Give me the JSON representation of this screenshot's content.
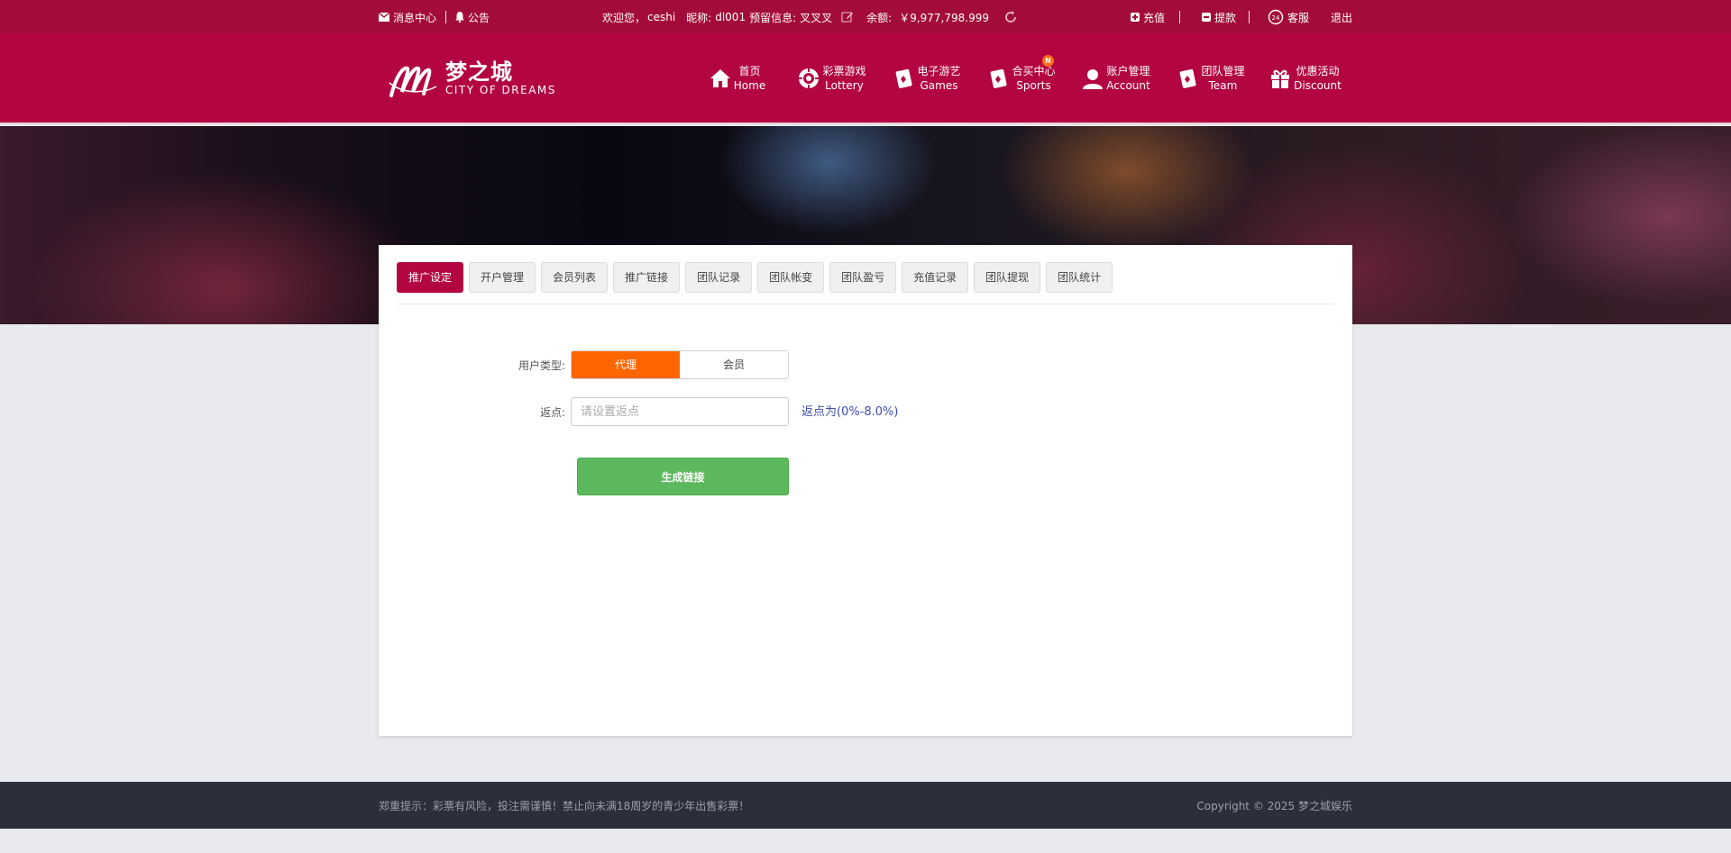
{
  "topbar": {
    "messages": "消息中心",
    "notice": "公告",
    "welcome": "欢迎您，",
    "username": "ceshi",
    "nickname_label": "昵称:",
    "nickname": "dl001",
    "reserved_label": "预留信息:",
    "reserved": "叉叉叉",
    "balance_label": "余额:",
    "balance": "￥9,977,798.999",
    "recharge": "充值",
    "withdraw": "提款",
    "service": "客服",
    "logout": "退出"
  },
  "logo": {
    "cn": "梦之城",
    "en": "CITY OF DREAMS"
  },
  "nav": [
    {
      "cn": "首页",
      "en": "Home",
      "icon": "home-icon"
    },
    {
      "cn": "彩票游戏",
      "en": "Lottery",
      "icon": "lottery-icon"
    },
    {
      "cn": "电子游艺",
      "en": "Games",
      "icon": "card-icon"
    },
    {
      "cn": "合买中心",
      "en": "Sports",
      "icon": "card-icon",
      "badge": "N"
    },
    {
      "cn": "账户管理",
      "en": "Account",
      "icon": "user-icon"
    },
    {
      "cn": "团队管理",
      "en": "Team",
      "icon": "card-icon"
    },
    {
      "cn": "优惠活动",
      "en": "Discount",
      "icon": "gift-icon"
    }
  ],
  "tabs": [
    "推广设定",
    "开户管理",
    "会员列表",
    "推广链接",
    "团队记录",
    "团队帐变",
    "团队盈亏",
    "充值记录",
    "团队提现",
    "团队统计"
  ],
  "form": {
    "user_type_label": "用户类型:",
    "type_agent": "代理",
    "type_member": "会员",
    "rebate_label": "返点:",
    "rebate_placeholder": "请设置返点",
    "rebate_value": "",
    "rebate_hint": "返点为(0%-8.0%)",
    "generate_button": "生成链接"
  },
  "footer": {
    "notice": "郑重提示：彩票有风险，投注需谨慎！禁止向未满18周岁的青少年出售彩票！",
    "copyright": "Copyright © 2025 梦之城娱乐"
  },
  "colors": {
    "brand": "#b30541",
    "topbar": "#a30c3a",
    "accent": "#ff6600",
    "success": "#5cb85c"
  }
}
